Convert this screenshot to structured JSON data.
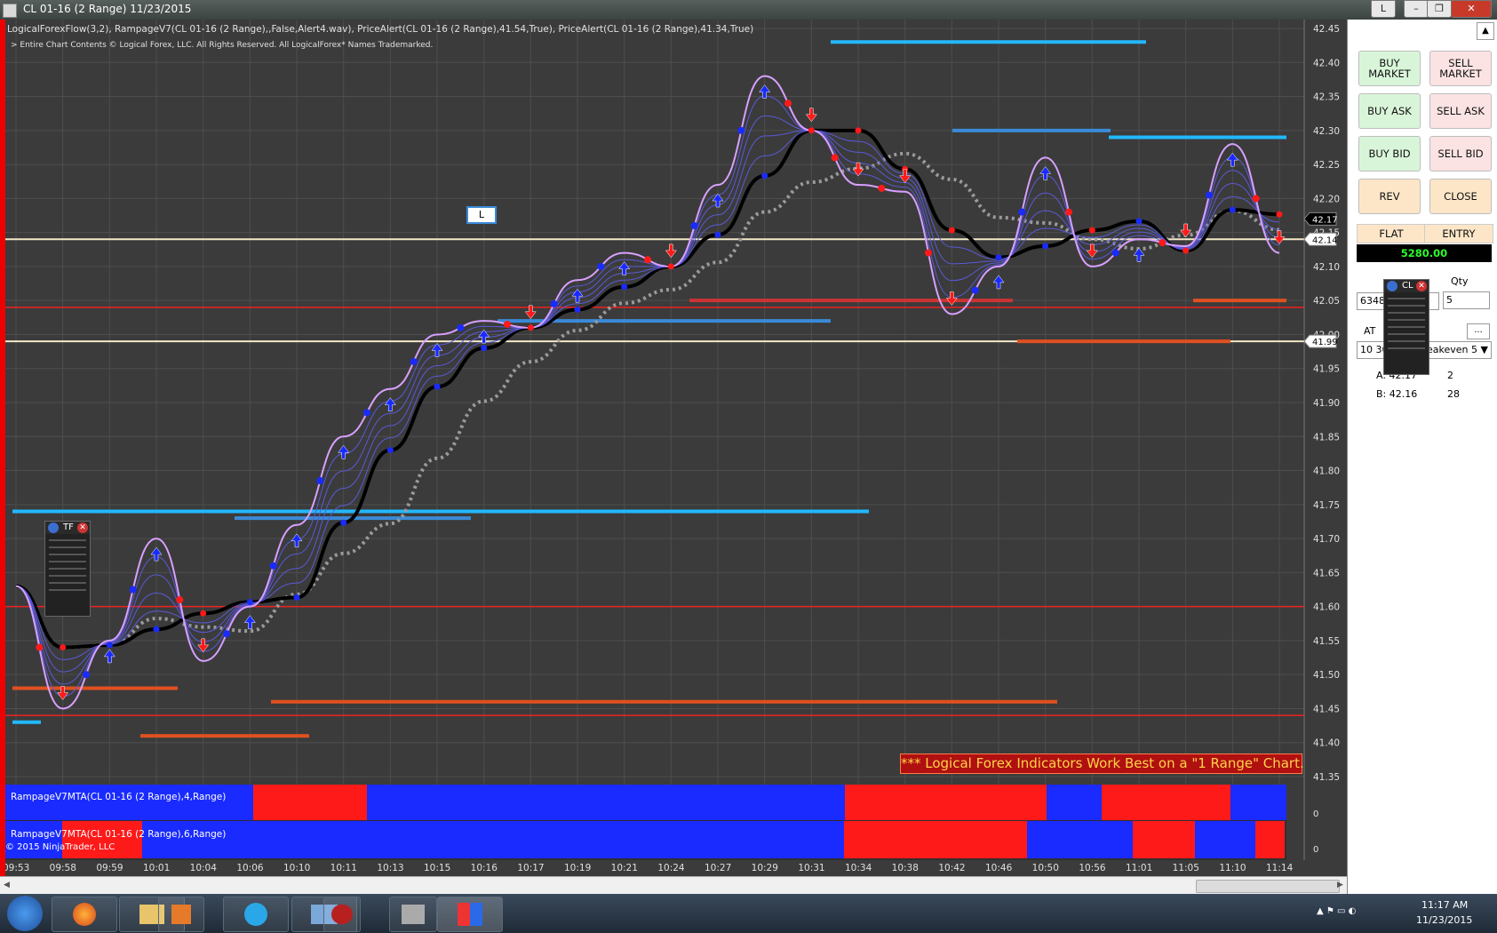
{
  "window": {
    "title": "CL 01-16 (2 Range)  11/23/2015",
    "buttons": {
      "pin": "L",
      "minimize": "–",
      "restore": "❐",
      "close": "✕"
    }
  },
  "chart": {
    "indicators_line": "LogicalForexFlow(3,2),  RampageV7(CL 01-16 (2 Range),,False,Alert4.wav), PriceAlert(CL 01-16 (2 Range),41.54,True), PriceAlert(CL 01-16 (2 Range),41.34,True)",
    "copyright_line": "> Entire Chart Contents © Logical Forex, LLC. All Rights Reserved. All LogicalForex* Names Trademarked.",
    "marker_label": "L",
    "price_ticks": [
      "42.45",
      "42.40",
      "42.35",
      "42.30",
      "42.25",
      "42.20",
      "42.15",
      "42.10",
      "42.05",
      "42.00",
      "41.95",
      "41.90",
      "41.85",
      "41.80",
      "41.75",
      "41.70",
      "41.65",
      "41.60",
      "41.55",
      "41.50",
      "41.45",
      "41.40",
      "41.35"
    ],
    "price_flags": [
      "42.17",
      "42.14",
      "41.99"
    ],
    "time_ticks": [
      "09:53",
      "09:58",
      "09:59",
      "10:01",
      "10:04",
      "10:06",
      "10:10",
      "10:11",
      "10:13",
      "10:15",
      "10:16",
      "10:17",
      "10:19",
      "10:21",
      "10:24",
      "10:27",
      "10:29",
      "10:31",
      "10:34",
      "10:38",
      "10:42",
      "10:46",
      "10:50",
      "10:56",
      "11:01",
      "11:05",
      "11:10",
      "11:14"
    ],
    "banner": "*** Logical Forex Indicators Work Best on a \"1 Range\" Chart.",
    "panel1_label": "RampageV7MTA(CL 01-16 (2 Range),4,Range)",
    "panel2_label": "RampageV7MTA(CL 01-16 (2 Range),6,Range)",
    "panel_zero": "0",
    "ninja_copyright": "© 2015 NinjaTrader, LLC",
    "mini_tf_label": "TF",
    "mini_cl_label": "CL"
  },
  "chart_data": {
    "type": "line",
    "title": "CL 01-16 (2 Range)",
    "xlabel": "",
    "ylabel": "",
    "ylim": [
      41.35,
      42.45
    ],
    "x": [
      "09:53",
      "09:58",
      "09:59",
      "10:01",
      "10:04",
      "10:06",
      "10:10",
      "10:11",
      "10:13",
      "10:15",
      "10:16",
      "10:17",
      "10:19",
      "10:21",
      "10:24",
      "10:27",
      "10:29",
      "10:31",
      "10:34",
      "10:38",
      "10:42",
      "10:46",
      "10:50",
      "10:56",
      "11:01",
      "11:05",
      "11:10",
      "11:14"
    ],
    "series": [
      {
        "name": "price",
        "values": [
          41.63,
          41.45,
          41.55,
          41.7,
          41.52,
          41.6,
          41.72,
          41.85,
          41.92,
          42.0,
          42.02,
          42.01,
          42.08,
          42.12,
          42.1,
          42.22,
          42.38,
          42.3,
          42.22,
          42.21,
          42.03,
          42.1,
          42.26,
          42.1,
          42.14,
          42.13,
          42.28,
          42.12
        ]
      }
    ],
    "horizontal_lines": [
      42.14,
      41.99,
      42.04,
      41.6,
      41.44
    ],
    "panels": [
      {
        "label": "RampageV7MTA(CL 01-16 (2 Range),4,Range)",
        "segments": [
          "blue",
          "red",
          "blue",
          "red",
          "blue",
          "red",
          "blue",
          "red"
        ]
      },
      {
        "label": "RampageV7MTA(CL 01-16 (2 Range),6,Range)",
        "segments": [
          "blue",
          "red",
          "blue",
          "red",
          "blue",
          "red",
          "blue",
          "red"
        ]
      }
    ]
  },
  "trade_panel": {
    "buy_market": "BUY\nMARKET",
    "sell_market": "SELL\nMARKET",
    "buy_ask": "BUY ASK",
    "sell_ask": "SELL ASK",
    "buy_bid": "BUY BID",
    "sell_bid": "SELL BID",
    "rev": "REV",
    "close": "CLOSE",
    "position": "FLAT",
    "entry": "ENTRY",
    "pnl": "5280.00",
    "qty_label": "Qty",
    "account": "6348",
    "qty": "5",
    "at_label": "AT",
    "more": "...",
    "strategy_prefix": "10 30",
    "strategy": "eakeven 5",
    "ask": "A: 42.17",
    "ask_size": "2",
    "bid": "B: 42.16",
    "bid_size": "28"
  },
  "taskbar": {
    "time": "11:17 AM",
    "date": "11/23/2015",
    "items": [
      "start",
      "firefox",
      "explorer",
      "media",
      "skype",
      "photos",
      "app1",
      "app2",
      "ninjatrader"
    ]
  },
  "colors": {
    "chart_bg": "#3b3b3b",
    "up": "#1a2bff",
    "down": "#ff1a1a",
    "avg": "#000000",
    "envelope": "#d8a0ff",
    "accent_line": "#22b8ff"
  }
}
